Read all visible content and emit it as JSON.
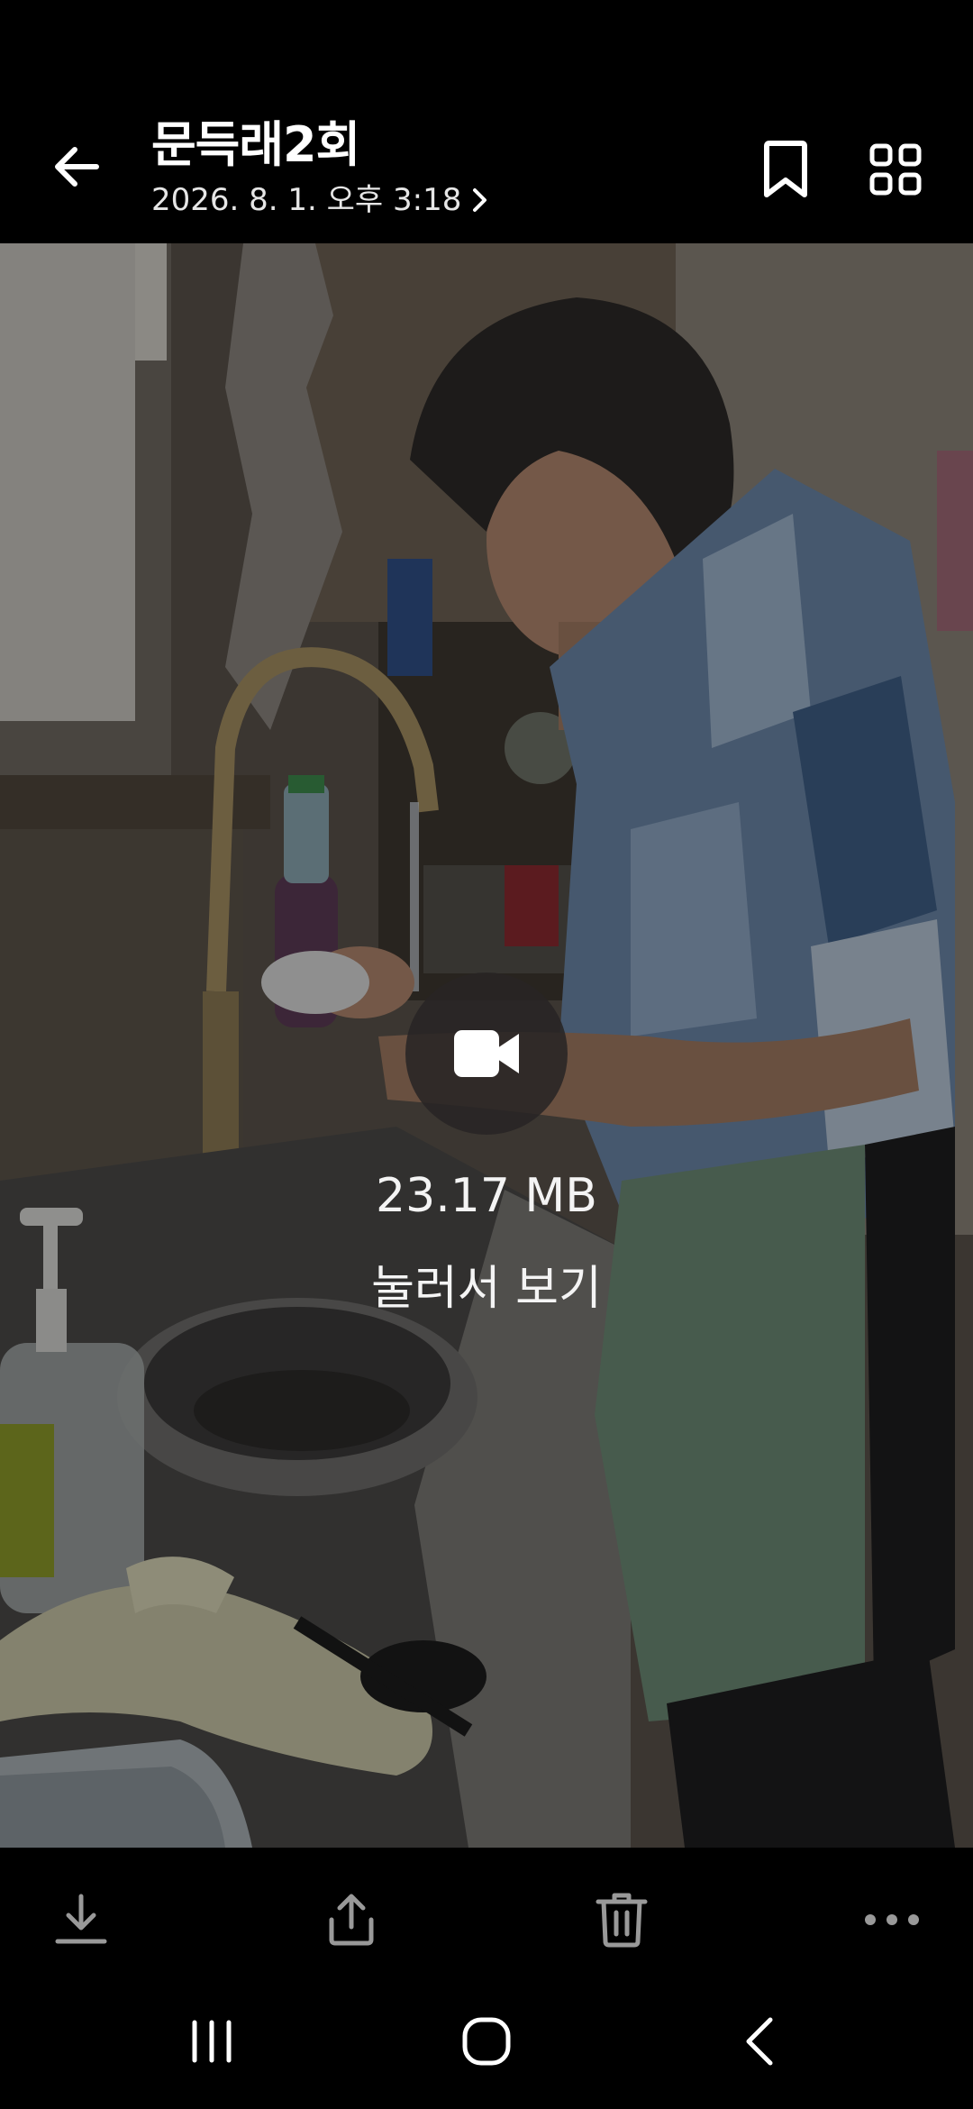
{
  "header": {
    "title": "문득래2회",
    "date": "2026. 8. 1. 오후 3:18",
    "back_icon": "arrow-left-icon",
    "bookmark_icon": "bookmark-icon",
    "grid_icon": "grid-icon"
  },
  "media": {
    "type_icon": "video-camera-icon",
    "file_size": "23.17 MB",
    "action_label": "눌러서 보기"
  },
  "toolbar": {
    "items": [
      {
        "icon": "download-icon"
      },
      {
        "icon": "share-icon"
      },
      {
        "icon": "trash-icon"
      },
      {
        "icon": "more-icon"
      }
    ]
  },
  "navbar": {
    "items": [
      {
        "icon": "recent-apps-icon"
      },
      {
        "icon": "home-icon"
      },
      {
        "icon": "back-icon"
      }
    ]
  },
  "colors": {
    "background": "#000000",
    "text": "#ffffff",
    "overlay_button": "#282424"
  }
}
